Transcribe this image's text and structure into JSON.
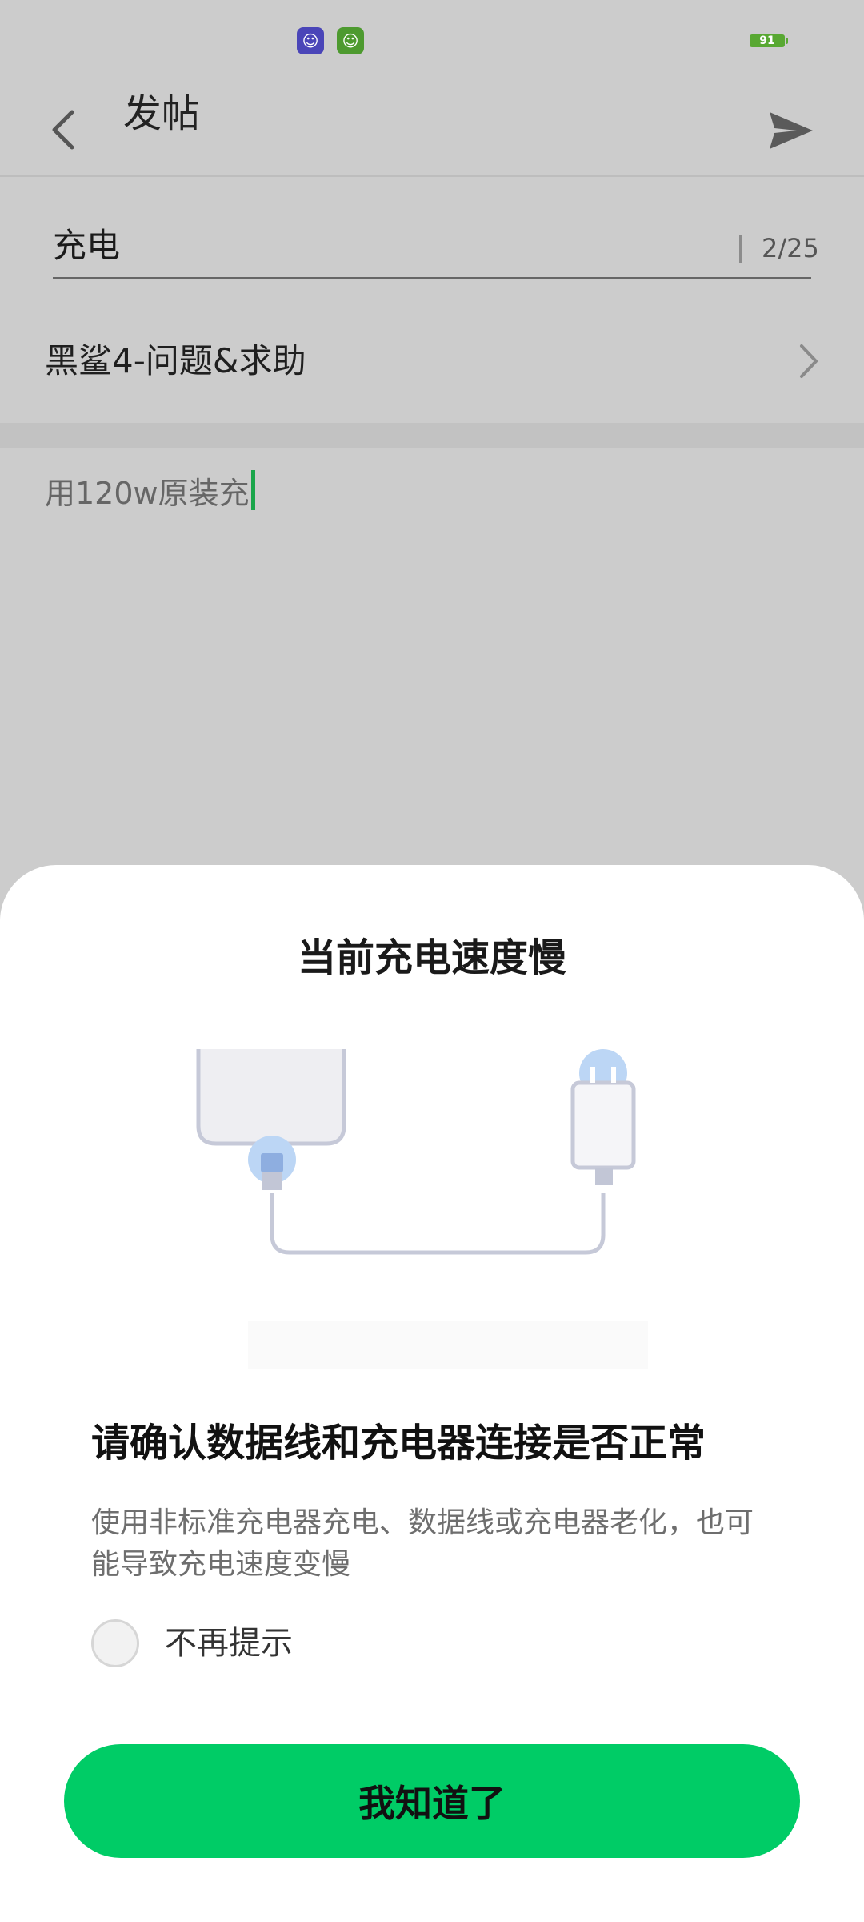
{
  "status_bar": {
    "battery_level": "91"
  },
  "header": {
    "title": "发帖"
  },
  "post": {
    "title_value": "充电",
    "title_counter": "2/25",
    "board": "黑鲨4-问题&求助",
    "body_text": "用120w原装充"
  },
  "dialog": {
    "title": "当前充电速度慢",
    "subtitle": "请确认数据线和充电器连接是否正常",
    "description": "使用非标准充电器充电、数据线或充电器老化，也可能导致充电速度变慢",
    "dont_show_again": "不再提示",
    "confirm_label": "我知道了"
  },
  "colors": {
    "accent": "#00cc66",
    "cursor": "#1aa54a",
    "dim_background": "#cccccc"
  }
}
